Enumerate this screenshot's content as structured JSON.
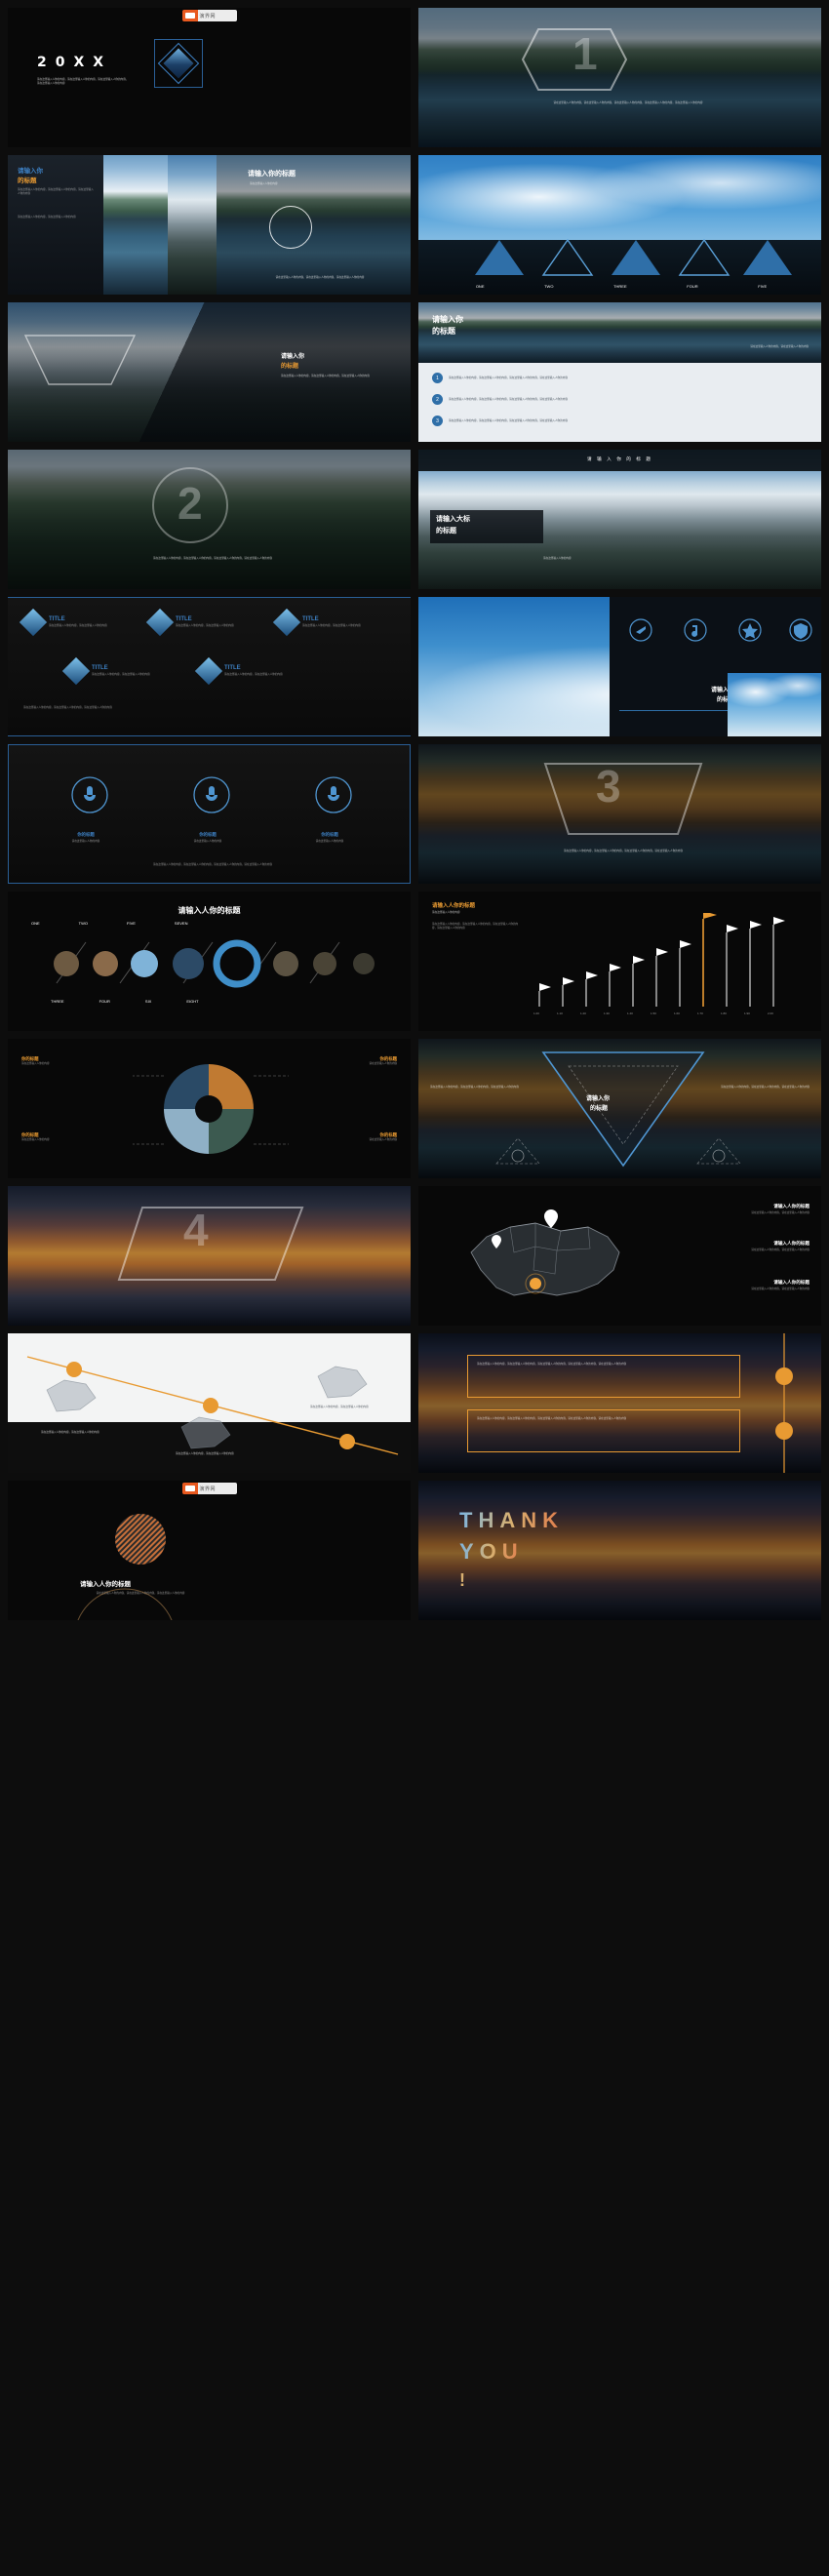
{
  "meta": {
    "watermark": "演界网",
    "filler_short": "请在这里输入人你的内容，请在这里输入人你的内容",
    "filler_med": "请在这里输入人你的内容，请在这里输入人你的内容，请在这里输入人你的内容，请在这里输入人你的内容",
    "filler_long": "请在这里输入人你的内容，请在这里输入人你的内容，请在这里输入人你的内容，请在这里输入人你的内容，请在这里输入人你的内容，请在这里输入人你的内容"
  },
  "slides": [
    {
      "id": "cover",
      "year": "20XX",
      "subtitle": "请在这里输入人你的内容，请在这里输入人你的内容，请在这里输入人你的内容，请在这里输入人你的内容"
    },
    {
      "id": "section-1",
      "number": "1",
      "body": "请在这里输入人你的内容，请在这里输入人你的内容，请在这里输入人你的内容，请在这里输入人你的内容，请在这里输入人你的内容"
    },
    {
      "id": "two-panel-title",
      "title_left_1": "请输入你",
      "title_left_2": "的标题",
      "body_left": "请在这里输入人你的内容，请在这里输入人你的内容，请在这里输入人你的内容",
      "body_left_2": "请在这里输入人你的内容，请在这里输入人你的内容"
    },
    {
      "id": "circle-title",
      "title": "请输入你的标题",
      "subtitle": "请在这里输入人你的内容",
      "footer": "请在这里输入人你的内容，请在这里输入人你的内容，请在这里输入人你的内容"
    },
    {
      "id": "five-triangles",
      "items": [
        "ONE",
        "TWO",
        "THREE",
        "FOUR",
        "FIVE"
      ]
    },
    {
      "id": "diagonal-photo",
      "title_1": "请输入你",
      "title_2": "的标题",
      "body": "请在这里输入人你的内容，请在这里输入人你的内容，请在这里输入人你的内容"
    },
    {
      "id": "numbered-list",
      "title_1": "请输入你",
      "title_2": "的标题",
      "note": "请在这里输入人你的内容，请在这里输入人你的内容",
      "items": [
        {
          "num": "1",
          "text": "请在这里输入人你的内容，请在这里输入人你的内容，请在这里输入人你的内容，请在这里输入人你的内容"
        },
        {
          "num": "2",
          "text": "请在这里输入人你的内容，请在这里输入人你的内容，请在这里输入人你的内容，请在这里输入人你的内容"
        },
        {
          "num": "3",
          "text": "请在这里输入人你的内容，请在这里输入人你的内容，请在这里输入人你的内容，请在这里输入人你的内容"
        }
      ]
    },
    {
      "id": "section-2",
      "number": "2",
      "body": "请在这里输入人你的内容，请在这里输入人你的内容，请在这里输入人你的内容，请在这里输入人你的内容"
    },
    {
      "id": "banner-title",
      "header": "请 输 入 你 的 标 题",
      "title_1": "请输入大标",
      "title_2": "的标题",
      "caption": "请在这里输入人你的内容"
    },
    {
      "id": "diamond-title-grid",
      "cards": [
        {
          "label": "TITLE",
          "body": "请在这里输入人你的内容，请在这里输入人你的内容"
        },
        {
          "label": "TITLE",
          "body": "请在这里输入人你的内容，请在这里输入人你的内容"
        },
        {
          "label": "TITLE",
          "body": "请在这里输入人你的内容，请在这里输入人你的内容"
        },
        {
          "label": "TITLE",
          "body": "请在这里输入人你的内容，请在这里输入人你的内容"
        },
        {
          "label": "TITLE",
          "body": "请在这里输入人你的内容，请在这里输入人你的内容"
        }
      ],
      "footer": "请在这里输入人你的内容，请在这里输入人你的内容，请在这里输入人你的内容"
    },
    {
      "id": "icon-row",
      "title_1": "请输入你",
      "title_2": "的标题",
      "icons": [
        "plane-icon",
        "music-icon",
        "star-icon",
        "shield-icon"
      ]
    },
    {
      "id": "three-circle-icons",
      "items": [
        {
          "title": "你的标题",
          "body": "请在这里输入人你的内容"
        },
        {
          "title": "你的标题",
          "body": "请在这里输入人你的内容"
        },
        {
          "title": "你的标题",
          "body": "请在这里输入人你的内容"
        }
      ],
      "footer": "请在这里输入人你的内容，请在这里输入人你的内容，请在这里输入人你的内容，请在这里输入人你的内容"
    },
    {
      "id": "section-3",
      "number": "3",
      "body": "请在这里输入人你的内容，请在这里输入人你的内容，请在这里输入人你的内容，请在这里输入人你的内容"
    },
    {
      "id": "timeline-circles",
      "title": "请输入人你的标题",
      "labels_top": [
        "ONE",
        "TWO",
        "FIVE",
        "SEVEN"
      ],
      "labels_bottom": [
        "THREE",
        "FOUR",
        "SIX",
        "EIGHT"
      ]
    },
    {
      "id": "bar-chart",
      "title": "请输入人你的标题",
      "subtitle": "请在这里输入人你的内容",
      "body": "请在这里输入人你的内容，请在这里输入人你的内容，请在这里输入人你的内容，请在这里输入人你的内容"
    },
    {
      "id": "pie-photo",
      "labels": [
        "你的标题",
        "你的标题",
        "你的标题",
        "你的标题"
      ],
      "body": "请在这里输入人你的内容"
    },
    {
      "id": "triangle-focus",
      "title_1": "请输入你",
      "title_2": "的标题",
      "left_body": "请在这里输入人你的内容，请在这里输入人你的内容，请在这里输入人你的内容",
      "right_body": "请在这里输入人你的内容，请在这里输入人你的内容，请在这里输入人你的内容"
    },
    {
      "id": "section-4",
      "number": "4"
    },
    {
      "id": "map-slide",
      "entries": [
        {
          "title": "请输入人你的标题",
          "body": "请在这里输入人你的内容，请在这里输入人你的内容"
        },
        {
          "title": "请输入人你的标题",
          "body": "请在这里输入人你的内容，请在这里输入人你的内容"
        },
        {
          "title": "请输入人你的标题",
          "body": "请在这里输入人你的内容，请在这里输入人你的内容"
        }
      ]
    },
    {
      "id": "map-diagonal",
      "items": [
        {
          "body": "请在这里输入人你的内容，请在这里输入人你的内容"
        },
        {
          "body": "请在这里输入人你的内容，请在这里输入人你的内容"
        },
        {
          "body": "请在这里输入人你的内容，请在这里输入人你的内容"
        }
      ]
    },
    {
      "id": "two-box-text",
      "box1": "请在这里输入人你的内容，请在这里输入人你的内容，请在这里输入人你的内容，请在这里输入人你的内容，请在这里输入人你的内容",
      "box2": "请在这里输入人你的内容，请在这里输入人你的内容，请在这里输入人你的内容，请在这里输入人你的内容，请在这里输入人你的内容"
    },
    {
      "id": "closing-left",
      "title": "请输入人你的标题",
      "body": "请在这里输入人你的内容，请在这里输入人你的内容，请在这里输入人你的内容"
    },
    {
      "id": "thank-you",
      "line1": "THANK",
      "line2": "YOU",
      "line3": "!"
    }
  ]
}
